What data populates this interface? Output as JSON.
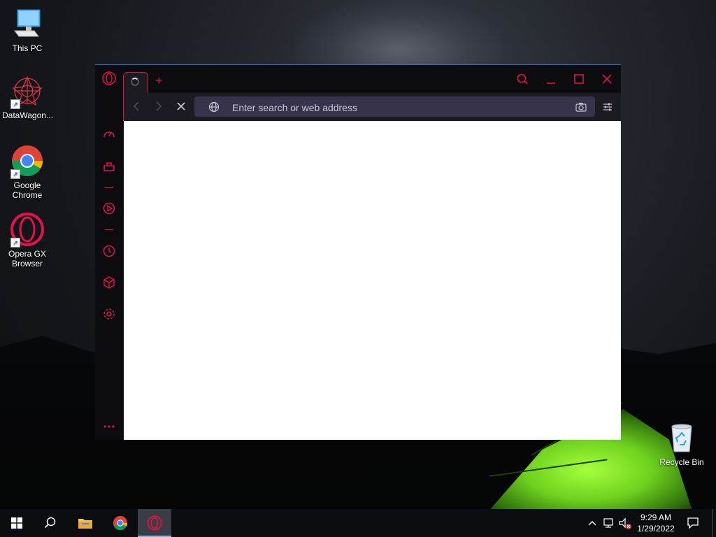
{
  "desktop": {
    "icons": [
      {
        "label": "This PC"
      },
      {
        "label": "DataWagon..."
      },
      {
        "label": "Google Chrome"
      },
      {
        "label": "Opera GX Browser"
      },
      {
        "label": "Recycle Bin"
      }
    ]
  },
  "browser": {
    "tab": {
      "loading": true
    },
    "new_tab_symbol": "+",
    "address_bar": {
      "placeholder": "Enter search or web address",
      "value": ""
    },
    "accent_color": "#e2124a"
  },
  "taskbar": {
    "clock": {
      "time": "9:29 AM",
      "date": "1/29/2022"
    }
  }
}
